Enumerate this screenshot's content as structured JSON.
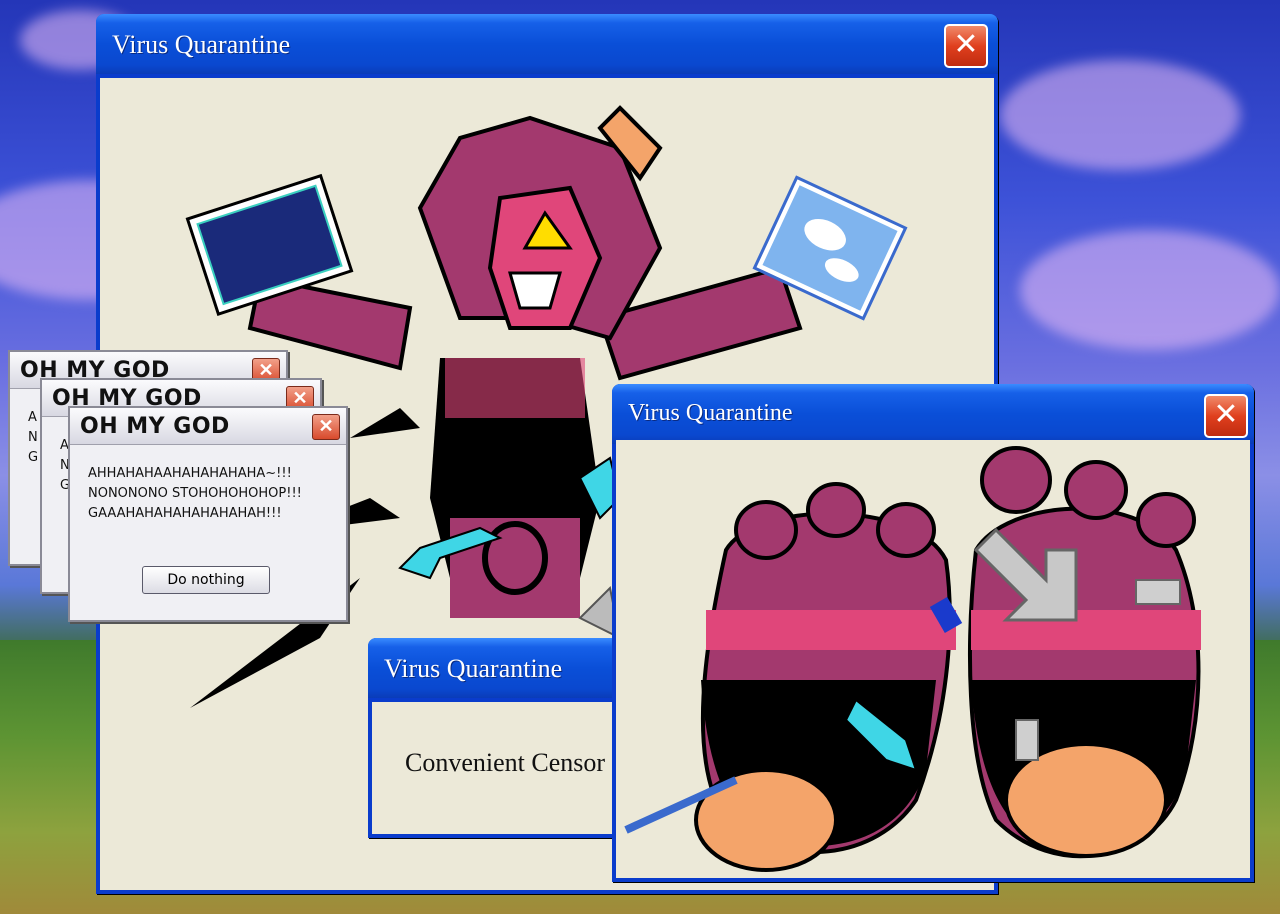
{
  "windows": {
    "main": {
      "title": "Virus Quarantine",
      "close": "✕"
    },
    "feet": {
      "title": "Virus Quarantine",
      "close": "✕"
    },
    "censor": {
      "title": "Virus Quarantine",
      "message": "Convenient Censor"
    }
  },
  "alerts": [
    {
      "title": "OH MY GOD",
      "close": "✕",
      "stub": "A\nN\nG"
    },
    {
      "title": "OH MY GOD",
      "close": "✕",
      "stub": "A\nN\nG"
    },
    {
      "title": "OH MY GOD",
      "close": "✕",
      "message": "AHHAHAHAAHAHAHAHAHA~!!!\nNONONONO STOHOHOHOHOP!!!\nGAAAHAHAHAHAHAHAHAH!!!",
      "button": "Do nothing"
    }
  ],
  "colors": {
    "xp_blue": "#0a3ccc",
    "magenta": "#a3396e",
    "pink": "#e0467a",
    "orange": "#f4a46a",
    "cyan": "#3fd6e6"
  }
}
